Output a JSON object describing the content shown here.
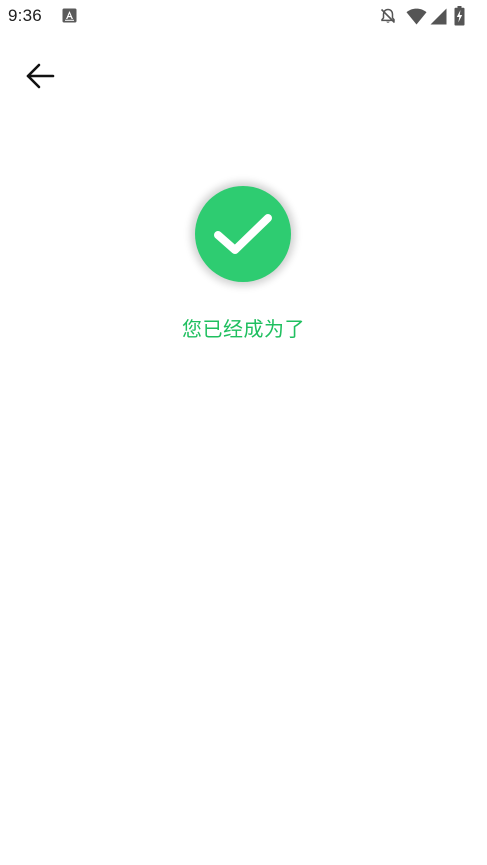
{
  "status_bar": {
    "time": "9:36",
    "icons": [
      "app-notification-icon",
      "bell-off-icon",
      "wifi-icon",
      "signal-icon",
      "battery-charging-icon"
    ]
  },
  "toolbar": {
    "back_icon": "arrow-left-icon"
  },
  "main": {
    "success_icon": "check-circle-icon",
    "message": "您已经成为了"
  },
  "colors": {
    "success_green": "#2ecc71",
    "message_green": "#1fbf5f"
  }
}
